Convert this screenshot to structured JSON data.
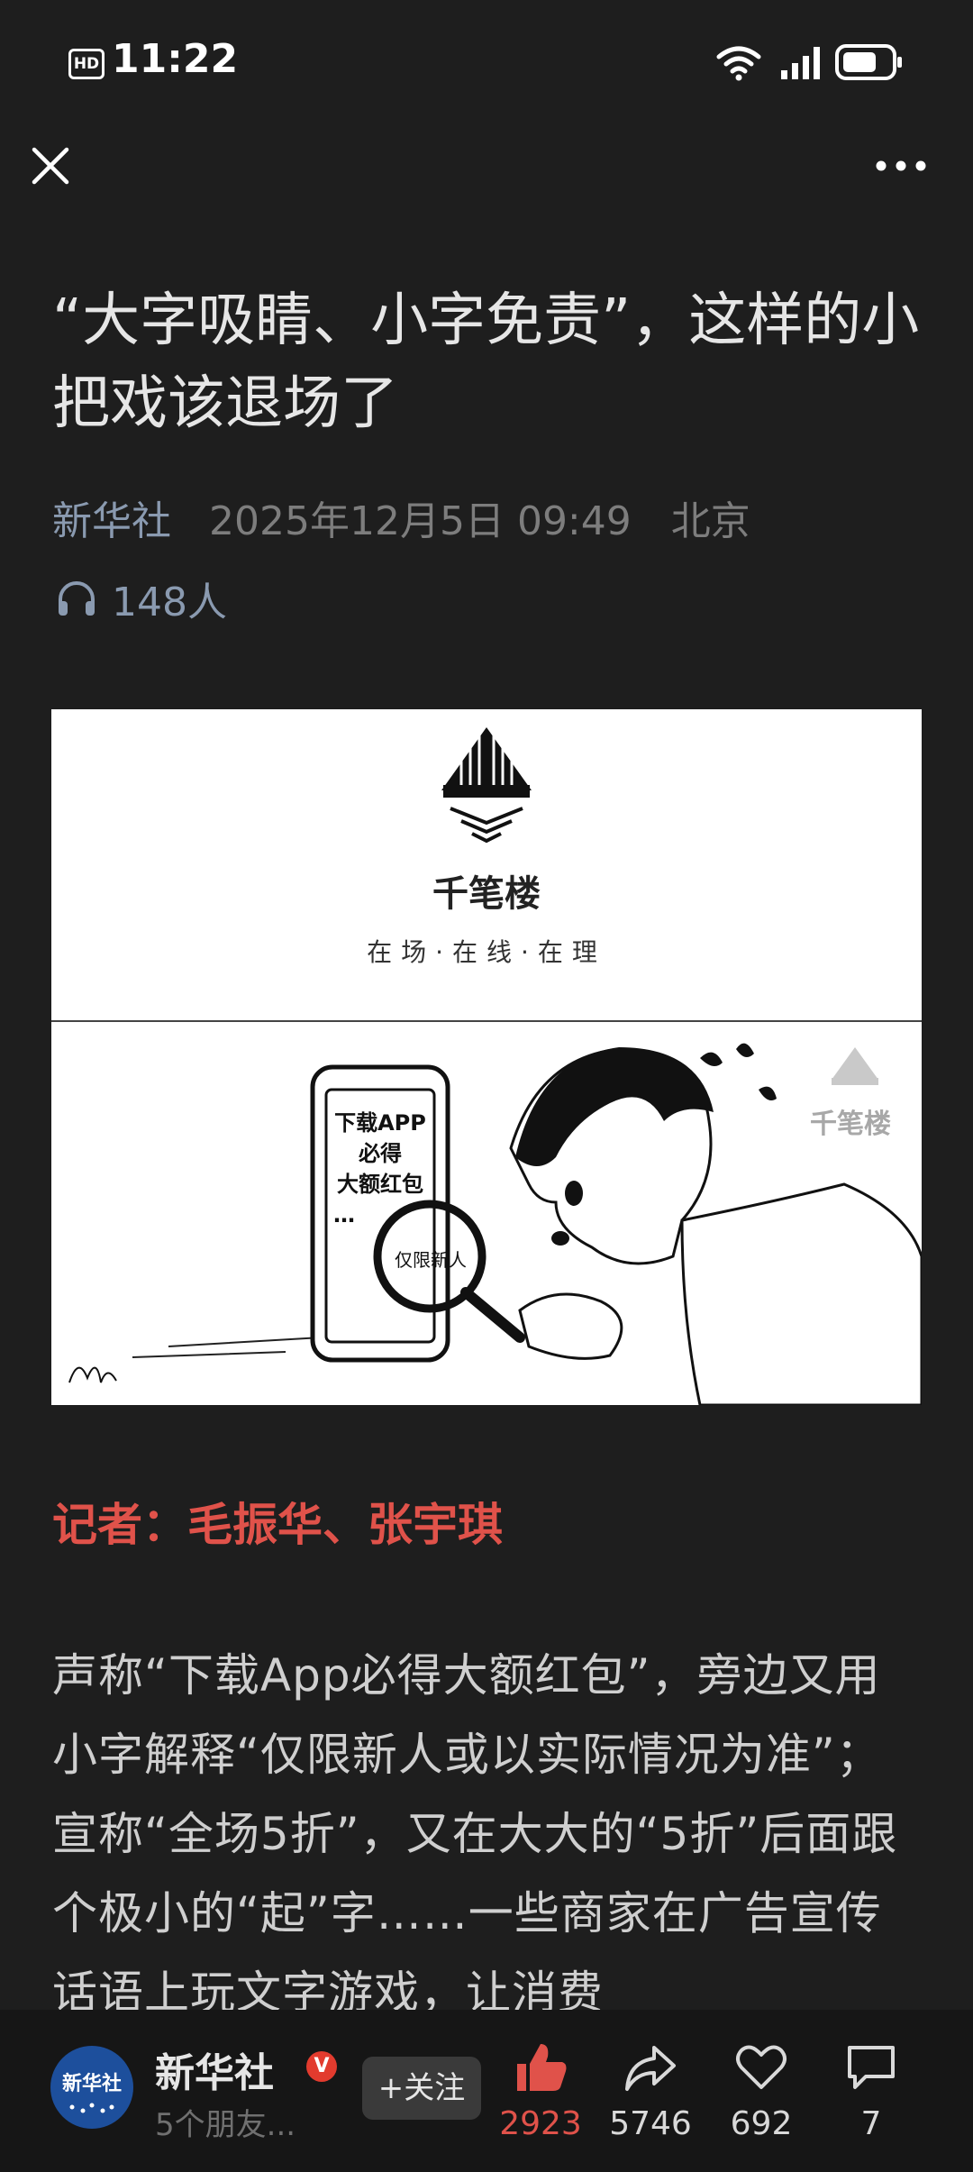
{
  "status_bar": {
    "hd_label": "HD",
    "time": "11:22"
  },
  "article": {
    "title": "“大字吸睛、小字免责”，这样的小把戏该退场了",
    "source": "新华社",
    "datetime": "2025年12月5日 09:49",
    "location": "北京",
    "listeners": "148人",
    "figure": {
      "brand": "千笔楼",
      "slogan": "在场·在线·在理",
      "phone_lines": [
        "下载APP",
        "必得",
        "大额红包",
        "…"
      ],
      "magnifier_text": "仅限新人",
      "watermark": "千笔楼"
    },
    "reporter": "记者：毛振华、张宇琪",
    "body": "声称“下载App必得大额红包”，旁边又用小字解释“仅限新人或以实际情况为准”；宣称“全场5折”，又在大大的“5折”后面跟个极小的“起”字……一些商家在广告宣传话语上玩文字游戏，让消费"
  },
  "bottom_bar": {
    "publisher": "新华社",
    "avatar_text": "新华社",
    "verified": "V",
    "friends": "5个朋友...",
    "follow": "+关注",
    "likes": "2923",
    "shares": "5746",
    "favorites": "692",
    "comments": "7"
  },
  "colors": {
    "background": "#1e1e1e",
    "accent_red": "#e0524a",
    "meta_blue_gray": "#8a9ab0"
  }
}
